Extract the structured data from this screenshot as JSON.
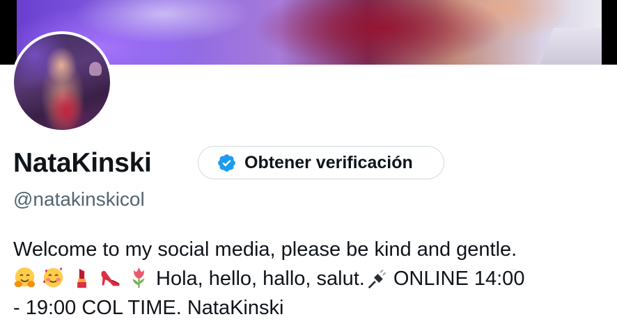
{
  "profile": {
    "display_name": "NataKinski",
    "handle": "@natakinskicol",
    "verify_button_label": "Obtener verificación",
    "bio": {
      "line1": "Welcome to my social media, please be kind and gentle.",
      "line2_text": "Hola, hello, hallo, salut.",
      "line2_tail": "ONLINE 14:00",
      "line3": "- 19:00 COL TIME. NataKinski",
      "emojis": [
        "hugging-face",
        "smiling-face-with-hearts",
        "lipstick",
        "high-heeled-shoe",
        "tulip",
        "electric-plug"
      ]
    }
  },
  "colors": {
    "text_primary": "#0f1419",
    "text_secondary": "#536471",
    "verified_blue": "#1d9bf0",
    "button_border": "#cfd9de"
  }
}
